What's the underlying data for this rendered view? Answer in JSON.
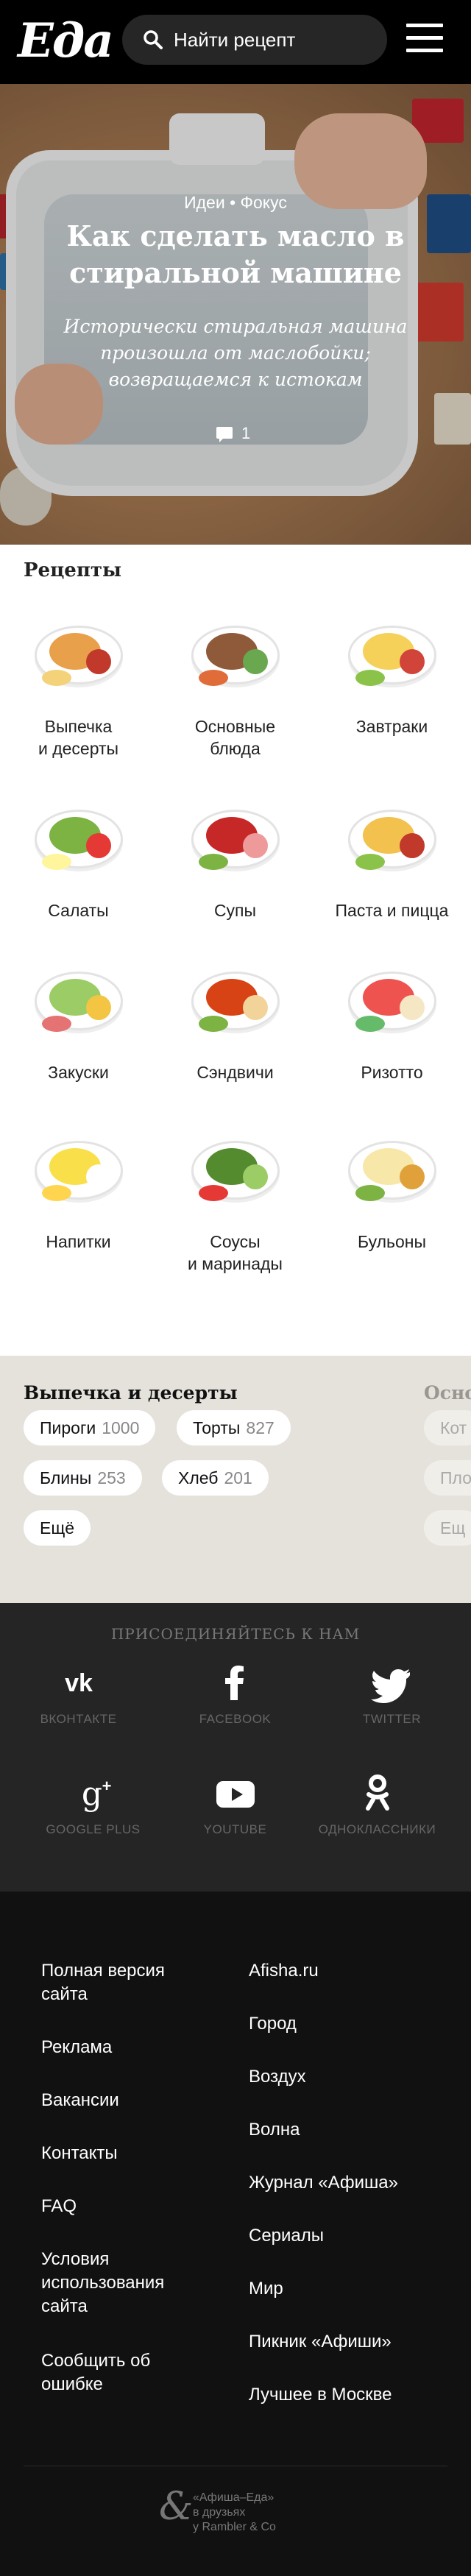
{
  "header": {
    "logo": "Еда",
    "search_label": "Найти рецепт"
  },
  "hero": {
    "breadcrumbs": "Идеи • Фокус",
    "title": "Как сделать масло в стиральной машине",
    "lead": "Исторически стиральная машина произошла от маслобойки; возвращаемся к истокам",
    "comments_count": "1"
  },
  "recipes": {
    "title": "Рецепты",
    "categories": [
      {
        "label": "Выпечка\nи десерты",
        "icon": "pancakes-icon"
      },
      {
        "label": "Основные\nблюда",
        "icon": "main-dish-icon"
      },
      {
        "label": "Завтраки",
        "icon": "breakfast-icon"
      },
      {
        "label": "Салаты",
        "icon": "salad-icon"
      },
      {
        "label": "Супы",
        "icon": "soup-icon"
      },
      {
        "label": "Паста и пицца",
        "icon": "pasta-icon"
      },
      {
        "label": "Закуски",
        "icon": "snacks-icon"
      },
      {
        "label": "Сэндвичи",
        "icon": "sandwich-icon"
      },
      {
        "label": "Ризотто",
        "icon": "risotto-icon"
      },
      {
        "label": "Напитки",
        "icon": "drinks-icon"
      },
      {
        "label": "Соусы\nи маринады",
        "icon": "sauces-icon"
      },
      {
        "label": "Бульоны",
        "icon": "broth-icon"
      }
    ]
  },
  "tags": {
    "title": "Выпечка и десерты",
    "next_title": "Основ",
    "items": [
      {
        "name": "Пироги",
        "count": "1000"
      },
      {
        "name": "Торты",
        "count": "827"
      },
      {
        "name": "Блины",
        "count": "253"
      },
      {
        "name": "Хлеб",
        "count": "201"
      }
    ],
    "more": "Ещё",
    "next_items": [
      "Кот",
      "Пло",
      "Ещ"
    ]
  },
  "social": {
    "title": "ПРИСОЕДИНЯЙТЕСЬ К НАМ",
    "networks": [
      {
        "name": "ВКОНТАКТЕ",
        "icon": "vk-icon"
      },
      {
        "name": "FACEBOOK",
        "icon": "facebook-icon"
      },
      {
        "name": "TWITTER",
        "icon": "twitter-icon"
      },
      {
        "name": "GOOGLE PLUS",
        "icon": "google-plus-icon"
      },
      {
        "name": "YOUTUBE",
        "icon": "youtube-icon"
      },
      {
        "name": "ОДНОКЛАССНИКИ",
        "icon": "odnoklassniki-icon"
      }
    ]
  },
  "footer": {
    "left_links": [
      "Полная версия\nсайта",
      "Реклама",
      "Вакансии",
      "Контакты",
      "FAQ",
      "Условия\nиспользования\nсайта",
      "Сообщить об\nошибке"
    ],
    "right_links": [
      "Afisha.ru",
      "Город",
      "Воздух",
      "Волна",
      "Журнал «Афиша»",
      "Сериалы",
      "Мир",
      "Пикник «Афиши»",
      "Лучшее в Москве"
    ],
    "partner_mark": "&",
    "partner_text": "«Афиша–Еда»\nв друзьях\nу Rambler & Co"
  }
}
